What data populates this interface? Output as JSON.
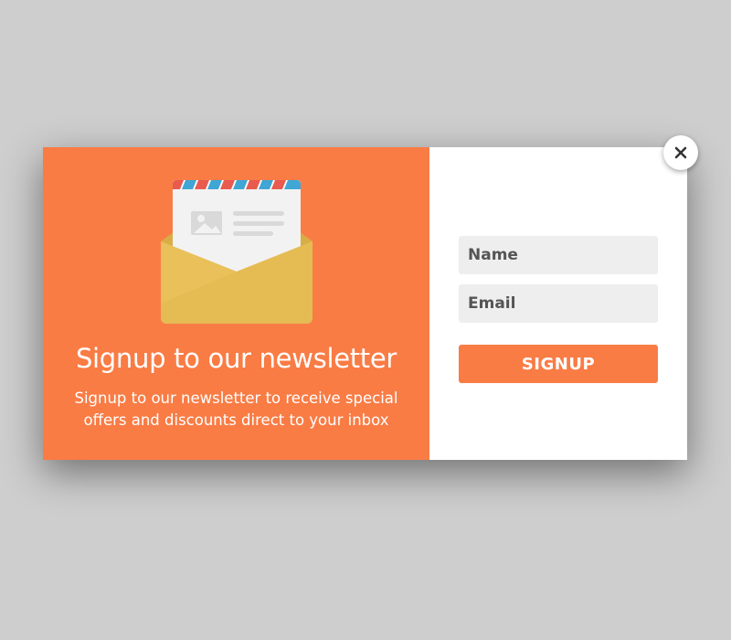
{
  "popup": {
    "title": "Signup to our newsletter",
    "description": "Signup to our newsletter to receive special offers and discounts direct to your inbox",
    "name_placeholder": "Name",
    "email_placeholder": "Email",
    "signup_label": "SIGNUP",
    "close_icon": "close-icon",
    "illustration_icon": "envelope-letter-icon"
  },
  "colors": {
    "accent": "#f97c45",
    "backdrop": "#cecece",
    "field_bg": "#eeeeee",
    "envelope": "#e9c05a"
  }
}
